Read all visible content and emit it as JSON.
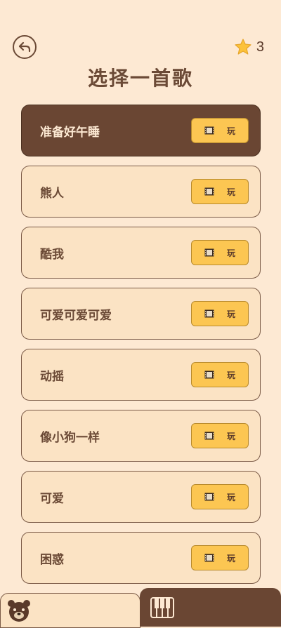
{
  "header": {
    "title": "选择一首歌",
    "star_count": "3"
  },
  "songs": [
    {
      "name": "准备好午睡",
      "play_label": "玩",
      "selected": true
    },
    {
      "name": "熊人",
      "play_label": "玩"
    },
    {
      "name": "酷我",
      "play_label": "玩"
    },
    {
      "name": "可爱可爱可爱",
      "play_label": "玩"
    },
    {
      "name": "动摇",
      "play_label": "玩"
    },
    {
      "name": "像小狗一样",
      "play_label": "玩"
    },
    {
      "name": "可爱",
      "play_label": "玩"
    },
    {
      "name": "困惑",
      "play_label": "玩"
    }
  ],
  "bottom_tabs": [
    {
      "icon": "bear-icon",
      "active": false
    },
    {
      "icon": "piano-icon",
      "active": true
    }
  ],
  "colors": {
    "background": "#fde9d3",
    "card": "#fbe3c4",
    "selected": "#6a4633",
    "button": "#fcc652",
    "text": "#6b4a36"
  }
}
